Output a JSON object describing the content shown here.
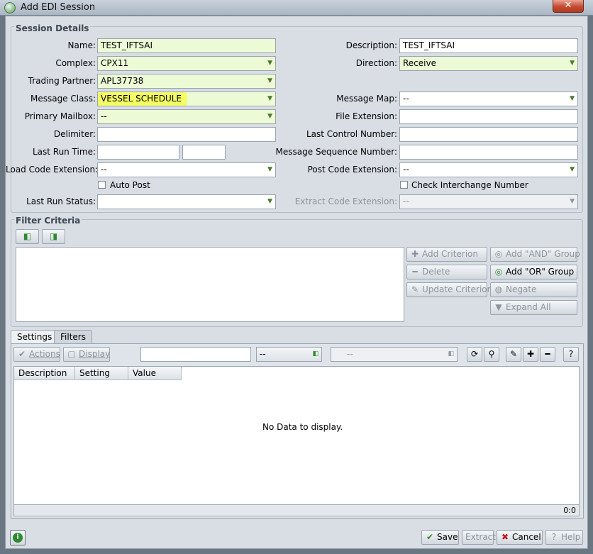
{
  "window": {
    "title": "Add EDI Session",
    "close_glyph": "✕"
  },
  "session_details": {
    "group_title": "Session Details",
    "name": {
      "label": "Name:",
      "value": "TEST_IFTSAI"
    },
    "complex": {
      "label": "Complex:",
      "value": "CPX11"
    },
    "trading_partner": {
      "label": "Trading Partner:",
      "value": "APL37738"
    },
    "message_class": {
      "label": "Message Class:",
      "value": "VESSEL SCHEDULE"
    },
    "primary_mailbox": {
      "label": "Primary Mailbox:",
      "value": "--"
    },
    "delimiter": {
      "label": "Delimiter:",
      "value": ""
    },
    "last_run_time": {
      "label": "Last Run Time:",
      "date": "",
      "time": ""
    },
    "load_code_extension": {
      "label": "Load Code Extension:",
      "value": "--"
    },
    "auto_post": {
      "label": "Auto Post",
      "checked": false
    },
    "last_run_status": {
      "label": "Last Run Status:",
      "value": ""
    },
    "description": {
      "label": "Description:",
      "value": "TEST_IFTSAI"
    },
    "direction": {
      "label": "Direction:",
      "value": "Receive"
    },
    "message_map": {
      "label": "Message Map:",
      "value": "--"
    },
    "file_extension": {
      "label": "File Extension:",
      "value": ""
    },
    "last_control_number": {
      "label": "Last Control Number:",
      "value": ""
    },
    "message_sequence_number": {
      "label": "Message Sequence Number:",
      "value": ""
    },
    "post_code_extension": {
      "label": "Post Code Extension:",
      "value": "--"
    },
    "check_interchange_number": {
      "label": "Check Interchange Number",
      "checked": false
    },
    "extract_code_extension": {
      "label": "Extract Code Extension:",
      "value": "--"
    }
  },
  "filter_criteria": {
    "group_title": "Filter Criteria",
    "add_criterion": "Add Criterion",
    "delete": "Delete",
    "update_criterion": "Update Criterion",
    "add_and_group": "Add \"AND\" Group",
    "add_or_group": "Add \"OR\" Group",
    "negate": "Negate",
    "expand_all": "Expand All"
  },
  "tabs": [
    {
      "label": "Settings",
      "active": true
    },
    {
      "label": "Filters",
      "active": false
    }
  ],
  "settings": {
    "actions": "Actions",
    "display": "Display",
    "search_value": "",
    "filter1_value": "--",
    "filter2_value": "--",
    "columns": [
      "Description",
      "Setting",
      "Value"
    ],
    "empty_message": "No Data to display.",
    "count": "0:0"
  },
  "footer": {
    "save": "Save",
    "extract": "Extract",
    "cancel": "Cancel",
    "help": "Help"
  },
  "colors": {
    "required_field": "#ecfbd6",
    "highlight": "#f4ff58",
    "accent_green": "#2e8a2e",
    "cancel_red": "#c8161b"
  }
}
